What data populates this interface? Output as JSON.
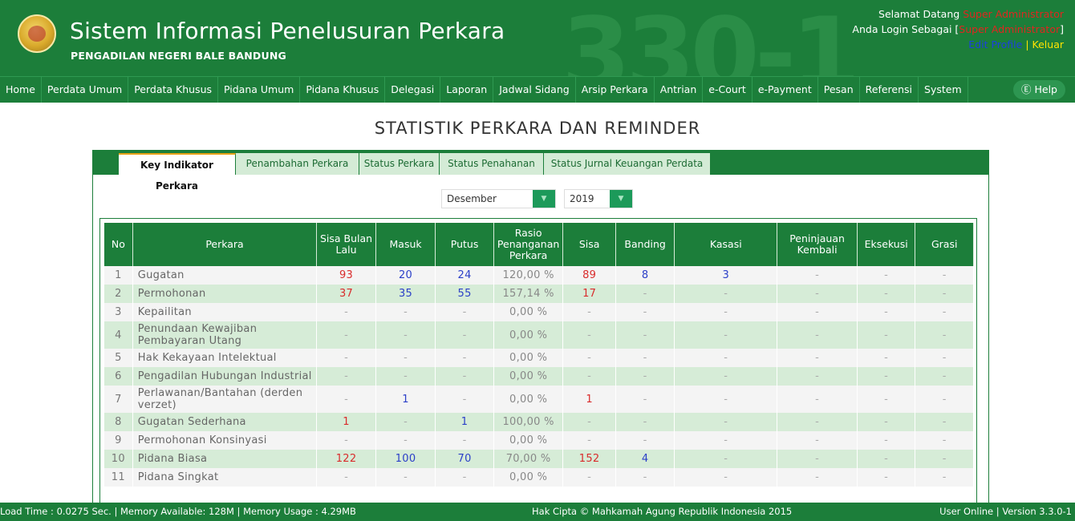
{
  "header": {
    "title": "Sistem Informasi Penelusuran Perkara",
    "subtitle": "PENGADILAN NEGERI BALE BANDUNG",
    "watermark": "330-1",
    "welcome_prefix": "Selamat Datang",
    "user_name": "Super Administrator",
    "login_prefix": "Anda Login Sebagai [",
    "role": "Super Administrator",
    "login_suffix": "]",
    "edit_profile": "Edit Profile",
    "separator": " | ",
    "logout": "Keluar"
  },
  "nav": {
    "items": [
      "Home",
      "Perdata Umum",
      "Perdata Khusus",
      "Pidana Umum",
      "Pidana Khusus",
      "Delegasi",
      "Laporan",
      "Jadwal Sidang",
      "Arsip Perkara",
      "Antrian",
      "e-Court",
      "e-Payment",
      "Pesan",
      "Referensi",
      "System"
    ],
    "help": "Ⓔ Help"
  },
  "page_title": "STATISTIK PERKARA DAN REMINDER",
  "tabs": [
    "Key Indikator Perkara",
    "Penambahan Perkara",
    "Status Perkara",
    "Status Penahanan",
    "Status Jurnal Keuangan Perdata"
  ],
  "filters": {
    "month": "Desember",
    "year": "2019",
    "dropdown_glyph": "▼"
  },
  "table": {
    "headers": [
      "No",
      "Perkara",
      "Sisa Bulan Lalu",
      "Masuk",
      "Putus",
      "Rasio Penanganan Perkara",
      "Sisa",
      "Banding",
      "Kasasi",
      "Peninjauan Kembali",
      "Eksekusi",
      "Grasi"
    ],
    "rows": [
      {
        "no": "1",
        "perkara": "Gugatan",
        "sisa_lalu": "93",
        "masuk": "20",
        "putus": "24",
        "rasio": "120,00 %",
        "sisa": "89",
        "banding": "8",
        "kasasi": "3",
        "pk": "-",
        "eksekusi": "-",
        "grasi": "-"
      },
      {
        "no": "2",
        "perkara": "Permohonan",
        "sisa_lalu": "37",
        "masuk": "35",
        "putus": "55",
        "rasio": "157,14 %",
        "sisa": "17",
        "banding": "-",
        "kasasi": "-",
        "pk": "-",
        "eksekusi": "-",
        "grasi": "-"
      },
      {
        "no": "3",
        "perkara": "Kepailitan",
        "sisa_lalu": "-",
        "masuk": "-",
        "putus": "-",
        "rasio": "0,00 %",
        "sisa": "-",
        "banding": "-",
        "kasasi": "-",
        "pk": "-",
        "eksekusi": "-",
        "grasi": "-"
      },
      {
        "no": "4",
        "perkara": "Penundaan Kewajiban Pembayaran Utang",
        "sisa_lalu": "-",
        "masuk": "-",
        "putus": "-",
        "rasio": "0,00 %",
        "sisa": "-",
        "banding": "-",
        "kasasi": "-",
        "pk": "-",
        "eksekusi": "-",
        "grasi": "-"
      },
      {
        "no": "5",
        "perkara": "Hak Kekayaan Intelektual",
        "sisa_lalu": "-",
        "masuk": "-",
        "putus": "-",
        "rasio": "0,00 %",
        "sisa": "-",
        "banding": "-",
        "kasasi": "-",
        "pk": "-",
        "eksekusi": "-",
        "grasi": "-"
      },
      {
        "no": "6",
        "perkara": "Pengadilan Hubungan Industrial",
        "sisa_lalu": "-",
        "masuk": "-",
        "putus": "-",
        "rasio": "0,00 %",
        "sisa": "-",
        "banding": "-",
        "kasasi": "-",
        "pk": "-",
        "eksekusi": "-",
        "grasi": "-"
      },
      {
        "no": "7",
        "perkara": "Perlawanan/Bantahan (derden verzet)",
        "sisa_lalu": "-",
        "masuk": "1",
        "putus": "-",
        "rasio": "0,00 %",
        "sisa": "1",
        "banding": "-",
        "kasasi": "-",
        "pk": "-",
        "eksekusi": "-",
        "grasi": "-"
      },
      {
        "no": "8",
        "perkara": "Gugatan Sederhana",
        "sisa_lalu": "1",
        "masuk": "-",
        "putus": "1",
        "rasio": "100,00 %",
        "sisa": "-",
        "banding": "-",
        "kasasi": "-",
        "pk": "-",
        "eksekusi": "-",
        "grasi": "-"
      },
      {
        "no": "9",
        "perkara": "Permohonan Konsinyasi",
        "sisa_lalu": "-",
        "masuk": "-",
        "putus": "-",
        "rasio": "0,00 %",
        "sisa": "-",
        "banding": "-",
        "kasasi": "-",
        "pk": "-",
        "eksekusi": "-",
        "grasi": "-"
      },
      {
        "no": "10",
        "perkara": "Pidana Biasa",
        "sisa_lalu": "122",
        "masuk": "100",
        "putus": "70",
        "rasio": "70,00 %",
        "sisa": "152",
        "banding": "4",
        "kasasi": "-",
        "pk": "-",
        "eksekusi": "-",
        "grasi": "-"
      },
      {
        "no": "11",
        "perkara": "Pidana Singkat",
        "sisa_lalu": "-",
        "masuk": "-",
        "putus": "-",
        "rasio": "0,00 %",
        "sisa": "-",
        "banding": "-",
        "kasasi": "-",
        "pk": "-",
        "eksekusi": "-",
        "grasi": "-"
      }
    ]
  },
  "footer": {
    "left": "Load Time : 0.0275 Sec. | Memory Available: 128M | Memory Usage : 4.29MB",
    "center": "Hak Cipta © Mahkamah Agung Republik Indonesia 2015",
    "right": "User Online  |  Version 3.3.0-1"
  },
  "colors": {
    "primary_green": "#1c7e3a",
    "value_red": "#d92c2c",
    "value_blue": "#2b3fc8",
    "highlight_yellow": "#ffe400",
    "tab_accent": "#e8a317"
  }
}
